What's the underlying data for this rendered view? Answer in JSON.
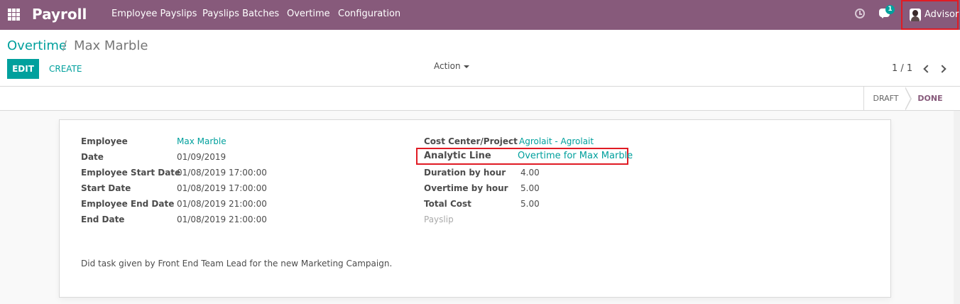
{
  "navbar": {
    "app_name": "Payroll",
    "menu": [
      {
        "label": "Employee Payslips"
      },
      {
        "label": "Payslips Batches"
      },
      {
        "label": "Overtime"
      },
      {
        "label": "Configuration"
      }
    ],
    "chat_badge_count": "1",
    "user_name": "Advisor",
    "icons": [
      "apps-grid-icon",
      "clock-icon",
      "chat-icon",
      "avatar"
    ]
  },
  "breadcrumb": {
    "parent": "Overtime",
    "separator": "/",
    "current": "Max Marble"
  },
  "buttons": {
    "edit": "EDIT",
    "create": "CREATE",
    "action": "Action"
  },
  "pager": {
    "value": "1 / 1"
  },
  "statusbar": {
    "stages": [
      "DRAFT",
      "DONE"
    ],
    "active_stage": "DONE"
  },
  "form": {
    "left": [
      {
        "label": "Employee",
        "value": "Max Marble",
        "is_link": true
      },
      {
        "label": "Date",
        "value": "01/09/2019"
      },
      {
        "label": "Employee Start Date",
        "value": "01/08/2019 17:00:00"
      },
      {
        "label": "Start Date",
        "value": "01/08/2019 17:00:00"
      },
      {
        "label": "Employee End Date",
        "value": "01/08/2019 21:00:00"
      },
      {
        "label": "End Date",
        "value": "01/08/2019 21:00:00"
      }
    ],
    "right": [
      {
        "label": "Cost Center/Project",
        "value": "Agrolait - Agrolait",
        "is_link": true
      },
      {
        "label": "Analytic Line",
        "value": "Overtime for Max Marble",
        "is_link": true
      },
      {
        "label": "Duration by hour",
        "value": "4.00"
      },
      {
        "label": "Overtime by hour",
        "value": "5.00"
      },
      {
        "label": "Total Cost",
        "value": "5.00"
      },
      {
        "label": "Payslip",
        "value": ""
      }
    ],
    "description": "Did task given by Front End Team Lead for the new Marketing Campaign."
  },
  "colors": {
    "brand": "#875a7b",
    "accent": "#00a09d",
    "highlight_border": "#e01b24"
  }
}
